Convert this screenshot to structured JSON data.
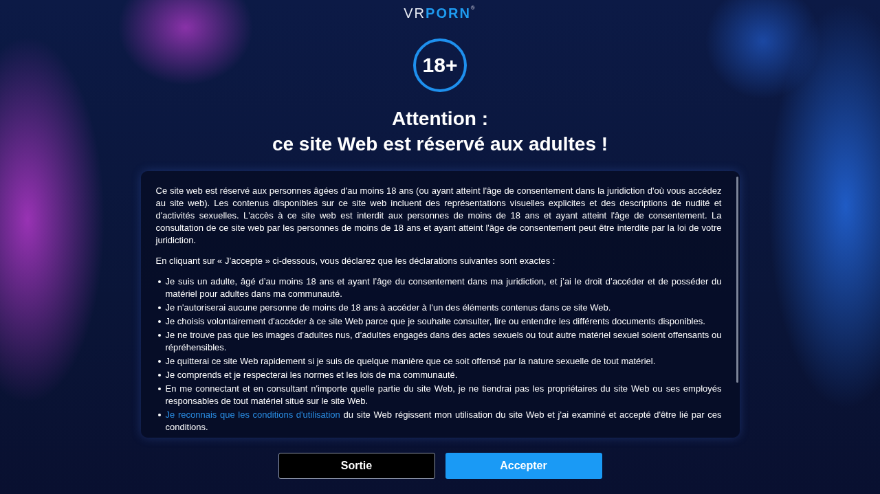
{
  "logo": {
    "prefix": "VR",
    "name": "PORN",
    "mark": "®"
  },
  "age_badge": "18+",
  "heading": [
    "Attention :",
    "ce site Web est réservé aux adultes !"
  ],
  "notice": {
    "paragraphs": [
      "Ce site web est réservé aux personnes âgées d'au moins 18 ans (ou ayant atteint l'âge de consentement dans la juridiction d'où vous accédez au site web). Les contenus disponibles sur ce site web incluent des représentations visuelles explicites et des descriptions de nudité et d'activités sexuelles. L'accès à ce site web est interdit aux personnes de moins de 18 ans et ayant atteint l'âge de consentement. La consultation de ce site web par les personnes de moins de 18 ans et ayant atteint l'âge de consentement peut être interdite par la loi de votre juridiction.",
      "En cliquant sur « J’accepte » ci-dessous, vous déclarez que les déclarations suivantes sont exactes :"
    ],
    "bullets": [
      {
        "text": "Je suis un adulte, âgé d’au moins 18 ans et ayant l’âge du consentement dans ma juridiction, et j’ai le droit d’accéder et de posséder du matériel pour adultes dans ma communauté."
      },
      {
        "text": "Je n'autoriserai aucune personne de moins de 18 ans à accéder à l'un des éléments contenus dans ce site Web."
      },
      {
        "text": "Je choisis volontairement d'accéder à ce site Web parce que je souhaite consulter, lire ou entendre les différents documents disponibles."
      },
      {
        "text": "Je ne trouve pas que les images d’adultes nus, d’adultes engagés dans des actes sexuels ou tout autre matériel sexuel soient offensants ou répréhensibles."
      },
      {
        "text": "Je quitterai ce site Web rapidement si je suis de quelque manière que ce soit offensé par la nature sexuelle de tout matériel."
      },
      {
        "text": "Je comprends et je respecterai les normes et les lois de ma communauté."
      },
      {
        "text": "En me connectant et en consultant n'importe quelle partie du site Web, je ne tiendrai pas les propriétaires du site Web ou ses employés responsables de tout matériel situé sur le site Web."
      },
      {
        "link": "Je reconnais que les conditions d'utilisation",
        "text": "du site Web régissent mon utilisation du site Web et j'ai examiné et accepté d'être lié par ces conditions."
      }
    ]
  },
  "buttons": [
    {
      "label": "Sortie",
      "kind": "secondary"
    },
    {
      "label": "Accepter",
      "kind": "primary"
    }
  ]
}
